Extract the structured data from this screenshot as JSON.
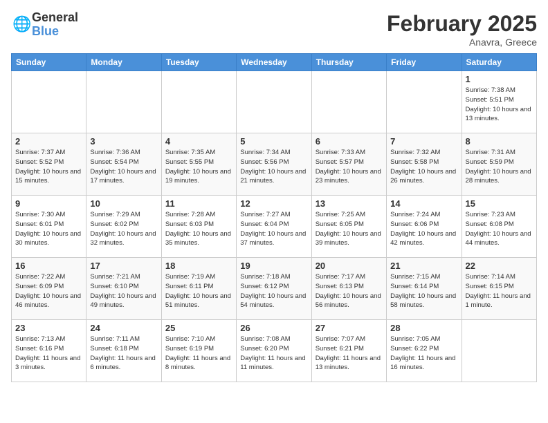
{
  "logo": {
    "general": "General",
    "blue": "Blue"
  },
  "title": "February 2025",
  "location": "Anavra, Greece",
  "days_of_week": [
    "Sunday",
    "Monday",
    "Tuesday",
    "Wednesday",
    "Thursday",
    "Friday",
    "Saturday"
  ],
  "weeks": [
    [
      {
        "day": "",
        "info": ""
      },
      {
        "day": "",
        "info": ""
      },
      {
        "day": "",
        "info": ""
      },
      {
        "day": "",
        "info": ""
      },
      {
        "day": "",
        "info": ""
      },
      {
        "day": "",
        "info": ""
      },
      {
        "day": "1",
        "info": "Sunrise: 7:38 AM\nSunset: 5:51 PM\nDaylight: 10 hours and 13 minutes."
      }
    ],
    [
      {
        "day": "2",
        "info": "Sunrise: 7:37 AM\nSunset: 5:52 PM\nDaylight: 10 hours and 15 minutes."
      },
      {
        "day": "3",
        "info": "Sunrise: 7:36 AM\nSunset: 5:54 PM\nDaylight: 10 hours and 17 minutes."
      },
      {
        "day": "4",
        "info": "Sunrise: 7:35 AM\nSunset: 5:55 PM\nDaylight: 10 hours and 19 minutes."
      },
      {
        "day": "5",
        "info": "Sunrise: 7:34 AM\nSunset: 5:56 PM\nDaylight: 10 hours and 21 minutes."
      },
      {
        "day": "6",
        "info": "Sunrise: 7:33 AM\nSunset: 5:57 PM\nDaylight: 10 hours and 23 minutes."
      },
      {
        "day": "7",
        "info": "Sunrise: 7:32 AM\nSunset: 5:58 PM\nDaylight: 10 hours and 26 minutes."
      },
      {
        "day": "8",
        "info": "Sunrise: 7:31 AM\nSunset: 5:59 PM\nDaylight: 10 hours and 28 minutes."
      }
    ],
    [
      {
        "day": "9",
        "info": "Sunrise: 7:30 AM\nSunset: 6:01 PM\nDaylight: 10 hours and 30 minutes."
      },
      {
        "day": "10",
        "info": "Sunrise: 7:29 AM\nSunset: 6:02 PM\nDaylight: 10 hours and 32 minutes."
      },
      {
        "day": "11",
        "info": "Sunrise: 7:28 AM\nSunset: 6:03 PM\nDaylight: 10 hours and 35 minutes."
      },
      {
        "day": "12",
        "info": "Sunrise: 7:27 AM\nSunset: 6:04 PM\nDaylight: 10 hours and 37 minutes."
      },
      {
        "day": "13",
        "info": "Sunrise: 7:25 AM\nSunset: 6:05 PM\nDaylight: 10 hours and 39 minutes."
      },
      {
        "day": "14",
        "info": "Sunrise: 7:24 AM\nSunset: 6:06 PM\nDaylight: 10 hours and 42 minutes."
      },
      {
        "day": "15",
        "info": "Sunrise: 7:23 AM\nSunset: 6:08 PM\nDaylight: 10 hours and 44 minutes."
      }
    ],
    [
      {
        "day": "16",
        "info": "Sunrise: 7:22 AM\nSunset: 6:09 PM\nDaylight: 10 hours and 46 minutes."
      },
      {
        "day": "17",
        "info": "Sunrise: 7:21 AM\nSunset: 6:10 PM\nDaylight: 10 hours and 49 minutes."
      },
      {
        "day": "18",
        "info": "Sunrise: 7:19 AM\nSunset: 6:11 PM\nDaylight: 10 hours and 51 minutes."
      },
      {
        "day": "19",
        "info": "Sunrise: 7:18 AM\nSunset: 6:12 PM\nDaylight: 10 hours and 54 minutes."
      },
      {
        "day": "20",
        "info": "Sunrise: 7:17 AM\nSunset: 6:13 PM\nDaylight: 10 hours and 56 minutes."
      },
      {
        "day": "21",
        "info": "Sunrise: 7:15 AM\nSunset: 6:14 PM\nDaylight: 10 hours and 58 minutes."
      },
      {
        "day": "22",
        "info": "Sunrise: 7:14 AM\nSunset: 6:15 PM\nDaylight: 11 hours and 1 minute."
      }
    ],
    [
      {
        "day": "23",
        "info": "Sunrise: 7:13 AM\nSunset: 6:16 PM\nDaylight: 11 hours and 3 minutes."
      },
      {
        "day": "24",
        "info": "Sunrise: 7:11 AM\nSunset: 6:18 PM\nDaylight: 11 hours and 6 minutes."
      },
      {
        "day": "25",
        "info": "Sunrise: 7:10 AM\nSunset: 6:19 PM\nDaylight: 11 hours and 8 minutes."
      },
      {
        "day": "26",
        "info": "Sunrise: 7:08 AM\nSunset: 6:20 PM\nDaylight: 11 hours and 11 minutes."
      },
      {
        "day": "27",
        "info": "Sunrise: 7:07 AM\nSunset: 6:21 PM\nDaylight: 11 hours and 13 minutes."
      },
      {
        "day": "28",
        "info": "Sunrise: 7:05 AM\nSunset: 6:22 PM\nDaylight: 11 hours and 16 minutes."
      },
      {
        "day": "",
        "info": ""
      }
    ]
  ]
}
